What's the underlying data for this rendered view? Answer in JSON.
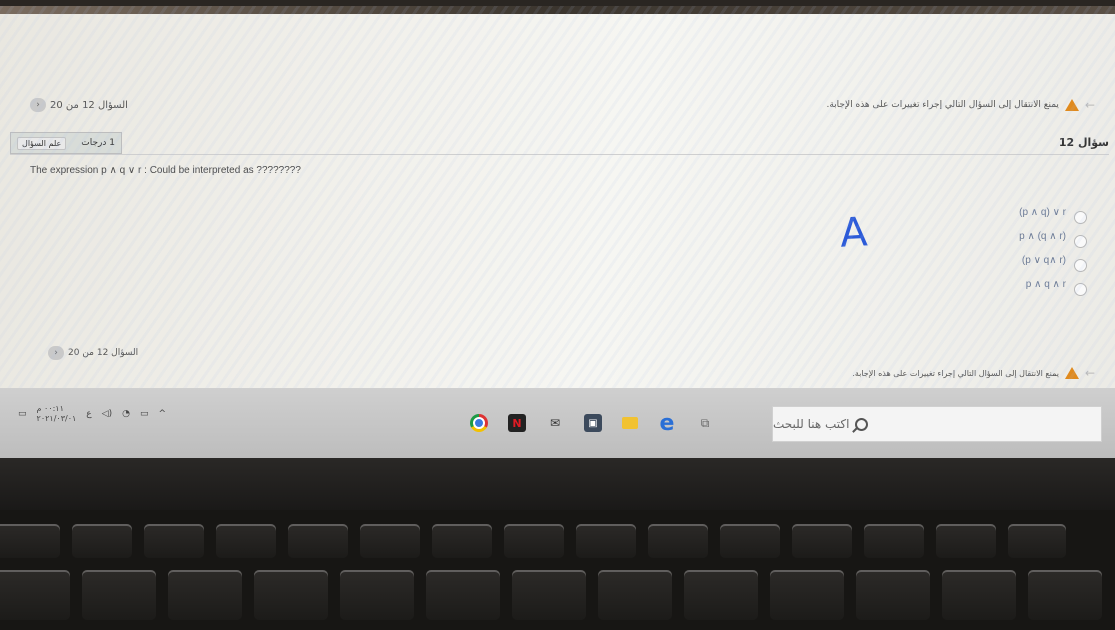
{
  "nav": {
    "counter_label": "السؤال 12 من 20",
    "warning_text": "يمنع الانتقال إلى السؤال التالي إجراء تغييرات على هذه الإجابة."
  },
  "question": {
    "title": "سؤال 12",
    "grade_text": "1 درجات",
    "flag_label": "علم السؤال",
    "text": "The expression p ∧ q ∨ r : Could be interpreted as ????????",
    "options": [
      {
        "label": "(p ∧ q) ∨ r"
      },
      {
        "label": "p ∧ (q ∧ r)"
      },
      {
        "label": "(p ∨ q∧ r)"
      },
      {
        "label": "p ∧ q ∧ r"
      }
    ],
    "handwritten_note": "A"
  },
  "footer_nav": {
    "counter_label": "السؤال 12 من 20",
    "warning_text": "يمنع الانتقال إلى السؤال التالي إجراء تغييرات على هذه الإجابة."
  },
  "taskbar": {
    "time": "٠٠:١١ م",
    "date": "٢٠٢١/٠٣/٠١",
    "lang": "ع",
    "search_placeholder": "اكتب هنا للبحث",
    "colors": {
      "warning": "#e08a1e",
      "accent": "#2a6fd6"
    }
  }
}
